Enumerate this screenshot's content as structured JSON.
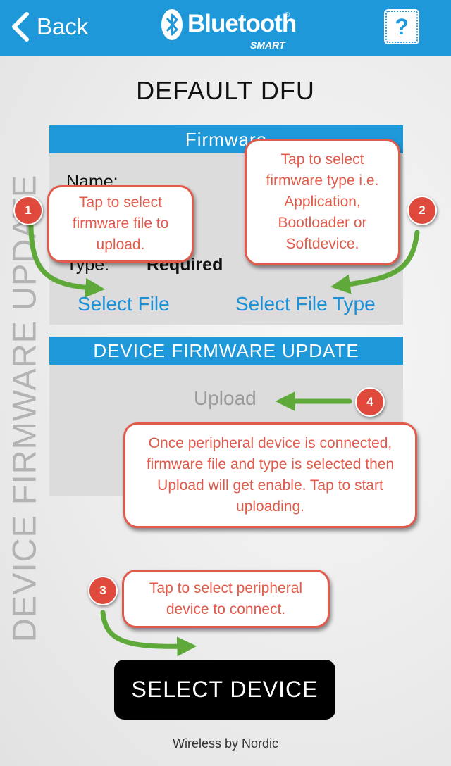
{
  "nav": {
    "back_label": "Back",
    "brand_word": "Bluetooth",
    "brand_reg": "®",
    "brand_sub": "SMART",
    "help_label": "?"
  },
  "side_title": "DEVICE FIRMWARE UPDATE",
  "page_title": "DEFAULT DFU",
  "firmware_panel": {
    "header": "Firmware",
    "name_label": "Name:",
    "type_label": "Type:",
    "type_value": "Required",
    "select_file_label": "Select File",
    "select_file_type_label": "Select File Type"
  },
  "dfu_panel": {
    "header": "DEVICE FIRMWARE UPDATE",
    "upload_label": "Upload"
  },
  "callouts": [
    {
      "number": "1",
      "text": "Tap to select firmware file to upload."
    },
    {
      "number": "2",
      "text": "Tap to select firmware type i.e. Application, Bootloader or Softdevice."
    },
    {
      "number": "3",
      "text": "Tap to select peripheral device to connect."
    },
    {
      "number": "4",
      "text": "Once peripheral device is connected, firmware file and type is selected then Upload will get enable. Tap to start uploading."
    }
  ],
  "select_device_label": "SELECT DEVICE",
  "footer": "Wireless by Nordic",
  "colors": {
    "accent": "#1e98d9",
    "callout": "#e15a4b",
    "arrow": "#5fa83a"
  }
}
